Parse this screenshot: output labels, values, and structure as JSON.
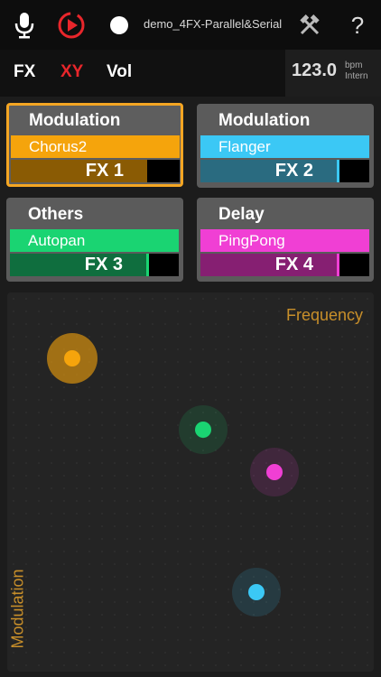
{
  "topbar": {
    "icons": [
      "microphone-icon",
      "play-record-icon",
      "record-dot-icon",
      "tools-icon",
      "help-icon"
    ],
    "help_label": "?",
    "project_name": "demo_4FX-Parallel&Serial"
  },
  "modes": [
    {
      "label": "FX",
      "active": false
    },
    {
      "label": "XY",
      "active": true
    },
    {
      "label": "Vol",
      "active": false
    }
  ],
  "tempo": {
    "value": "123.0",
    "unit": "bpm",
    "source": "Intern"
  },
  "fx_slots": [
    {
      "category": "Modulation",
      "effect": "Chorus2",
      "slot": "FX 1",
      "color": "#f5a40c",
      "dark": "#8a5b04",
      "selected": true,
      "level": 0.0
    },
    {
      "category": "Modulation",
      "effect": "Flanger",
      "slot": "FX 2",
      "color": "#3bc8f5",
      "dark": "#2a6b80",
      "selected": false,
      "level": 0.03
    },
    {
      "category": "Others",
      "effect": "Autopan",
      "slot": "FX 3",
      "color": "#1ad472",
      "dark": "#0f6e3e",
      "selected": false,
      "level": 0.03
    },
    {
      "category": "Delay",
      "effect": "PingPong",
      "slot": "FX 4",
      "color": "#f03fd4",
      "dark": "#861f72",
      "selected": false,
      "level": 0.03
    }
  ],
  "xy_pad": {
    "x_axis_label": "Frequency",
    "y_axis_label": "Modulation",
    "points": [
      {
        "fx": "FX 1",
        "x": 0.12,
        "y": 0.88,
        "color": "#f5a40c"
      },
      {
        "fx": "FX 3",
        "x": 0.54,
        "y": 0.66,
        "color": "#1ad472"
      },
      {
        "fx": "FX 4",
        "x": 0.77,
        "y": 0.53,
        "color": "#f03fd4"
      },
      {
        "fx": "FX 2",
        "x": 0.71,
        "y": 0.16,
        "color": "#3bc8f5"
      }
    ]
  }
}
